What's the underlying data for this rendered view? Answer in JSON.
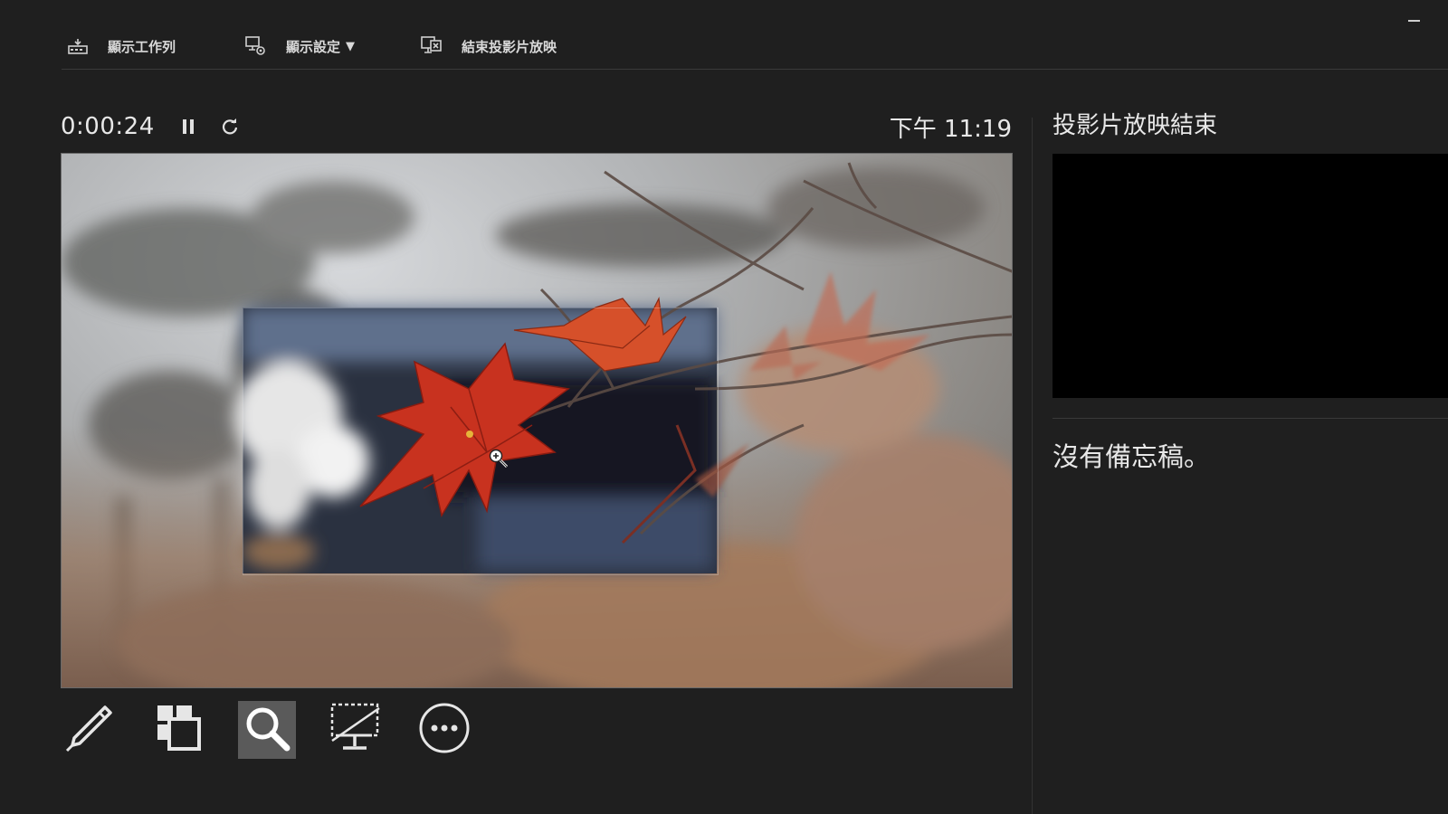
{
  "toolbar": {
    "show_taskbar_label": "顯示工作列",
    "display_settings_label": "顯示設定",
    "display_settings_caret": "▼",
    "end_show_label": "結束投影片放映"
  },
  "presenter": {
    "elapsed_time": "0:00:24",
    "clock": "下午 11:19",
    "next_slide_label": "投影片放映結束",
    "notes_text": "沒有備忘稿。"
  },
  "icons": {
    "taskbar": "taskbar-icon",
    "display_settings": "monitor-gear-icon",
    "end_show": "monitor-x-icon",
    "pause": "pause-icon",
    "reset": "refresh-icon",
    "pen": "pen-icon",
    "see_all_slides": "slides-grid-icon",
    "zoom": "magnifier-icon",
    "black_screen": "black-screen-icon",
    "more": "more-options-icon"
  },
  "tools": {
    "active": "zoom"
  },
  "colors": {
    "background": "#1f1f1f",
    "text": "#e8e8e8",
    "active_tool": "#5a5a5a",
    "preview": "#000000"
  }
}
